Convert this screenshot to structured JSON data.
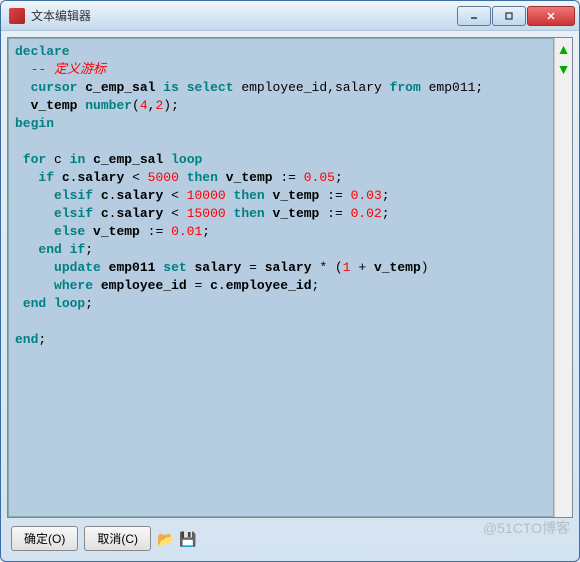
{
  "window": {
    "title": "文本编辑器"
  },
  "code": {
    "l1_declare": "declare",
    "l2_comment": "-- 定义游标",
    "l3a": "cursor",
    "l3b": "c_emp_sal",
    "l3c": "is",
    "l3d": "select",
    "l3e": "employee_id",
    "l3f": "salary",
    "l3g": "from",
    "l3h": "emp011",
    "l4a": "v_temp",
    "l4b": "number",
    "l4c": "4",
    "l4d": "2",
    "l5a": "begin",
    "l7a": "for",
    "l7b": "c",
    "l7c": "in",
    "l7d": "c_emp_sal",
    "l7e": "loop",
    "l8a": "if",
    "l8b": "c",
    "l8c": "salary",
    "l8d": "5000",
    "l8e": "then",
    "l8f": "v_temp",
    "l8g": "0.05",
    "l9a": "elsif",
    "l9b": "c",
    "l9c": "salary",
    "l9d": "10000",
    "l9e": "then",
    "l9f": "v_temp",
    "l9g": "0.03",
    "l10a": "elsif",
    "l10b": "c",
    "l10c": "salary",
    "l10d": "15000",
    "l10e": "then",
    "l10f": "v_temp",
    "l10g": "0.02",
    "l11a": "else",
    "l11b": "v_temp",
    "l11c": "0.01",
    "l12a": "end",
    "l12b": "if",
    "l13a": "update",
    "l13b": "emp011",
    "l13c": "set",
    "l13d": "salary",
    "l13e": "salary",
    "l13f": "1",
    "l13g": "v_temp",
    "l14a": "where",
    "l14b": "employee_id",
    "l14c": "c",
    "l14d": "employee_id",
    "l15a": "end",
    "l15b": "loop",
    "l17a": "end"
  },
  "buttons": {
    "ok": "确定(O)",
    "cancel": "取消(C)"
  },
  "watermark": "@51CTO博客",
  "watermark2": ""
}
